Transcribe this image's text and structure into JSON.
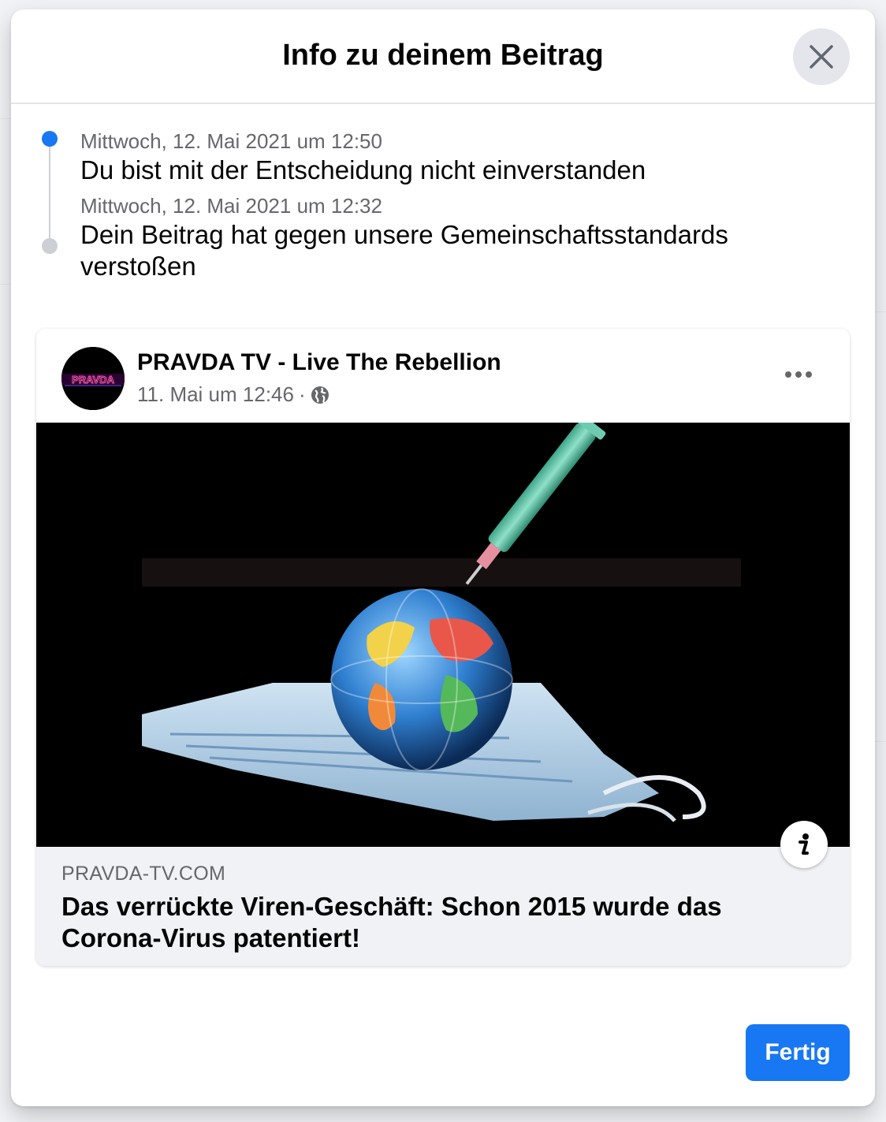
{
  "modal": {
    "title": "Info zu deinem Beitrag",
    "done_label": "Fertig"
  },
  "timeline": [
    {
      "time": "Mittwoch, 12. Mai 2021 um 12:50",
      "text": "Du bist mit der Entscheidung nicht einverstanden",
      "state": "active"
    },
    {
      "time": "Mittwoch, 12. Mai 2021 um 12:32",
      "text": "Dein Beitrag hat gegen unsere Gemeinschaftsstandards verstoßen",
      "state": "inactive"
    }
  ],
  "post": {
    "page_name": "PRAVDA TV - Live The Rebellion",
    "timestamp": "11. Mai um 12:46",
    "separator": "·",
    "audience_icon": "globe-icon",
    "avatar_text": "PRAVDA",
    "image_description_icon": "info-icon",
    "link": {
      "domain": "PRAVDA-TV.COM",
      "title": "Das verrückte Viren-Geschäft: Schon 2015 wurde das Corona-Virus patentiert!"
    }
  },
  "colors": {
    "accent": "#1877f2",
    "text_primary": "#050505",
    "text_secondary": "#65676b",
    "surface_grey": "#f0f2f5"
  }
}
